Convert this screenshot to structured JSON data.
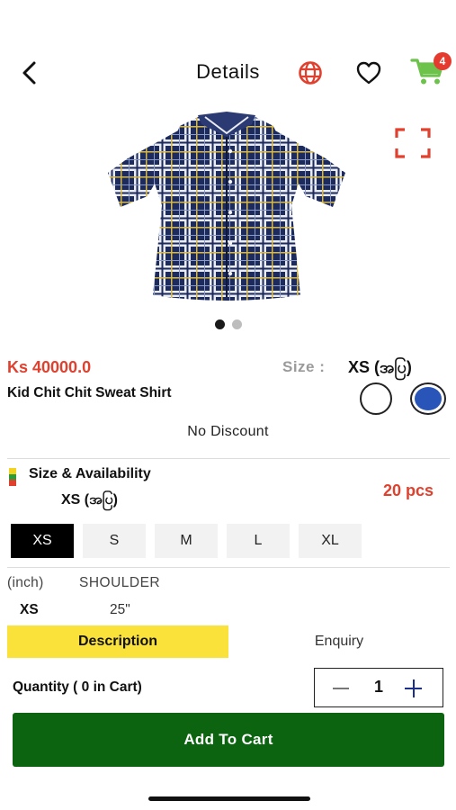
{
  "header": {
    "title": "Details",
    "cart_count": "4"
  },
  "product": {
    "price": "Ks 40000.0",
    "name": "Kid Chit Chit Sweat Shirt",
    "size_label": "Size :",
    "selected_size": "XS (အပြ)",
    "discount": "No Discount",
    "colors": [
      "#ffffff",
      "#2a55b8"
    ]
  },
  "availability": {
    "title": "Size & Availability",
    "size": "XS (အပြ)",
    "stock": "20 pcs"
  },
  "sizes": [
    "XS",
    "S",
    "M",
    "L",
    "XL"
  ],
  "measurements": {
    "unit": "(inch)",
    "column": "SHOULDER",
    "row_size": "XS",
    "row_value": "25\""
  },
  "tabs": {
    "description": "Description",
    "enquiry": "Enquiry"
  },
  "quantity": {
    "label": "Quantity ( 0 in Cart)",
    "value": "1"
  },
  "add_to_cart": "Add To Cart",
  "colors": {
    "accent_red": "#e0402e",
    "primary_green": "#0c6410",
    "tab_yellow": "#fbe23a",
    "cart_green": "#6cc24a"
  }
}
